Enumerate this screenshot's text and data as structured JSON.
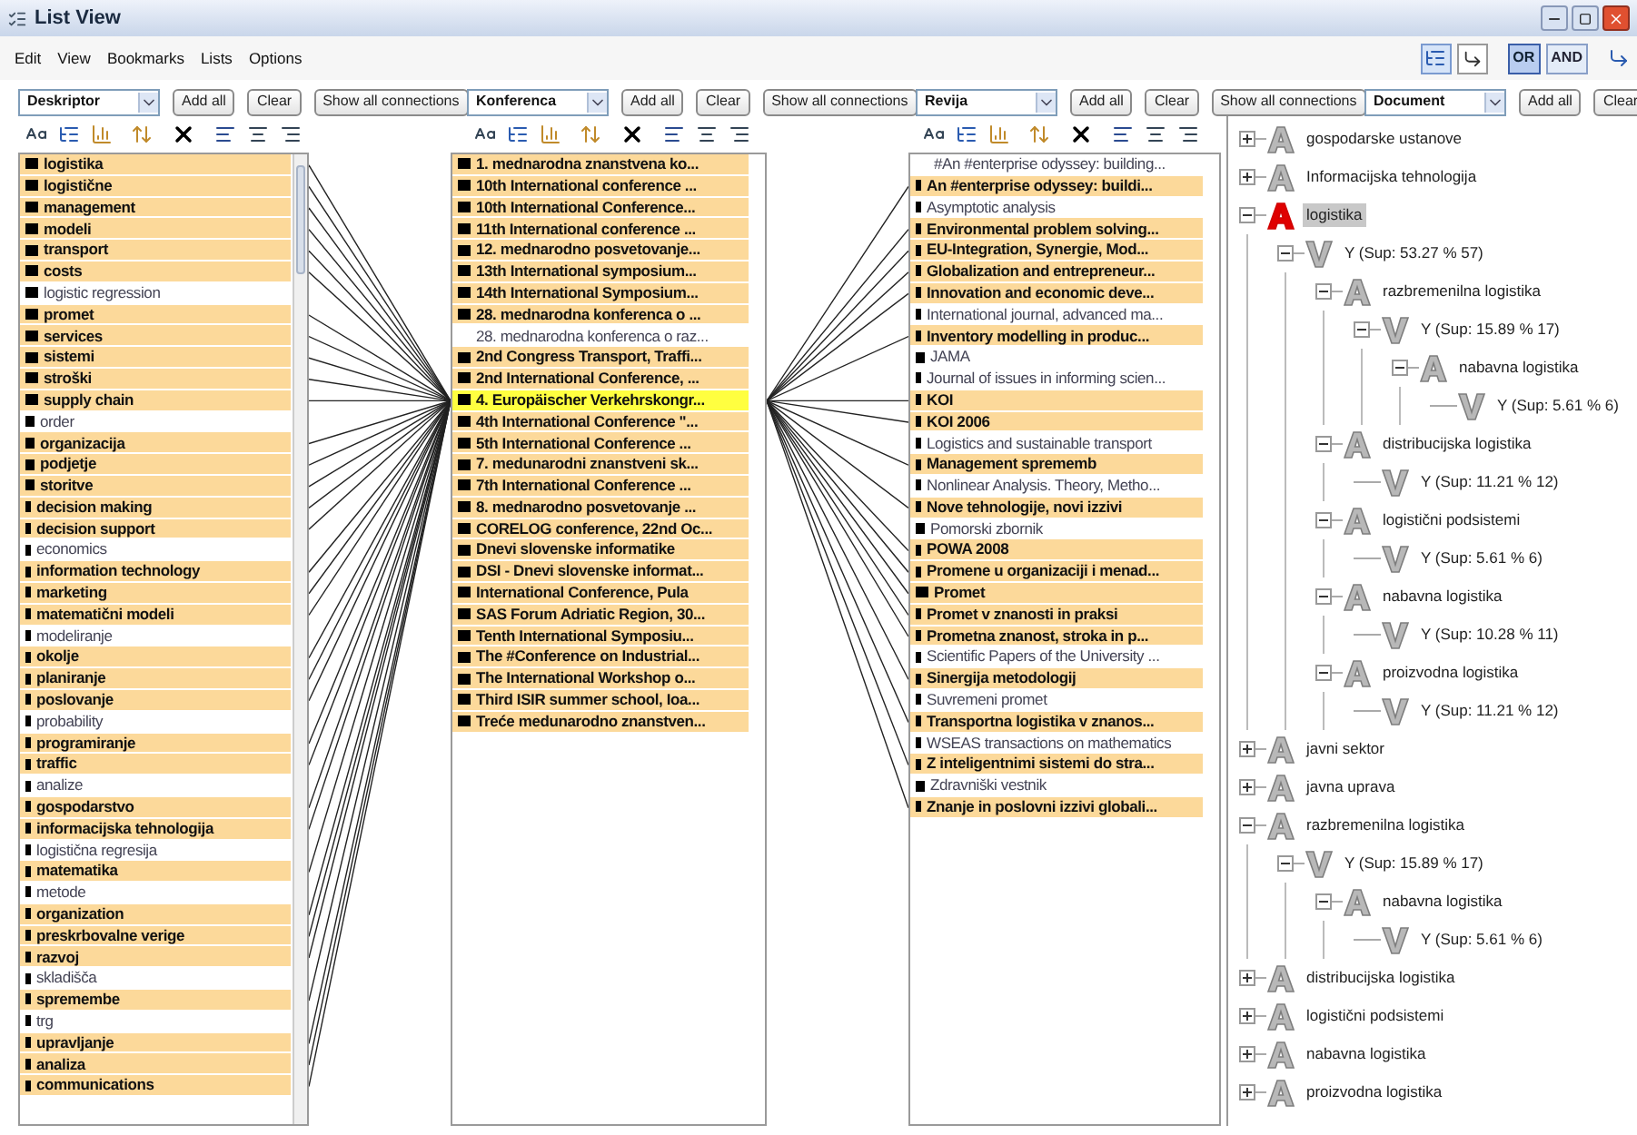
{
  "window": {
    "title": "List View"
  },
  "menu": [
    "Edit",
    "View",
    "Bookmarks",
    "Lists",
    "Options"
  ],
  "mode_buttons": [
    {
      "label": "OR",
      "selected": true
    },
    {
      "label": "AND",
      "selected": false
    }
  ],
  "panes": [
    {
      "combo": "Deskriptor",
      "buttons": [
        "Add all",
        "Clear",
        "Show all connections"
      ]
    },
    {
      "combo": "Konferenca",
      "buttons": [
        "Add all",
        "Clear",
        "Show all connections"
      ]
    },
    {
      "combo": "Revija",
      "buttons": [
        "Add all",
        "Clear",
        "Show all connections"
      ]
    },
    {
      "combo": "Document",
      "buttons": [
        "Add all",
        "Clear"
      ]
    }
  ],
  "lists": [
    {
      "items": [
        {
          "label": "logistika",
          "highlighted": true,
          "selected": false,
          "kind": "large"
        },
        {
          "label": "logistične",
          "highlighted": true,
          "selected": false,
          "kind": "large"
        },
        {
          "label": "management",
          "highlighted": true,
          "selected": false,
          "kind": "large"
        },
        {
          "label": "modeli",
          "highlighted": true,
          "selected": false,
          "kind": "large"
        },
        {
          "label": "transport",
          "highlighted": true,
          "selected": false,
          "kind": "large"
        },
        {
          "label": "costs",
          "highlighted": true,
          "selected": false,
          "kind": "large"
        },
        {
          "label": "logistic regression",
          "highlighted": false,
          "selected": false,
          "kind": "large"
        },
        {
          "label": "promet",
          "highlighted": true,
          "selected": false,
          "kind": "large"
        },
        {
          "label": "services",
          "highlighted": true,
          "selected": false,
          "kind": "large"
        },
        {
          "label": "sistemi",
          "highlighted": true,
          "selected": false,
          "kind": "large"
        },
        {
          "label": "stroški",
          "highlighted": true,
          "selected": false,
          "kind": "large"
        },
        {
          "label": "supply chain",
          "highlighted": true,
          "selected": false,
          "kind": "large"
        },
        {
          "label": "order",
          "highlighted": false,
          "selected": false,
          "kind": "medium"
        },
        {
          "label": "organizacija",
          "highlighted": true,
          "selected": false,
          "kind": "medium"
        },
        {
          "label": "podjetje",
          "highlighted": true,
          "selected": false,
          "kind": "medium"
        },
        {
          "label": "storitve",
          "highlighted": true,
          "selected": false,
          "kind": "medium"
        },
        {
          "label": "decision making",
          "highlighted": true,
          "selected": false,
          "kind": "small"
        },
        {
          "label": "decision support",
          "highlighted": true,
          "selected": false,
          "kind": "small"
        },
        {
          "label": "economics",
          "highlighted": false,
          "selected": false,
          "kind": "small"
        },
        {
          "label": "information technology",
          "highlighted": true,
          "selected": false,
          "kind": "small"
        },
        {
          "label": "marketing",
          "highlighted": true,
          "selected": false,
          "kind": "small"
        },
        {
          "label": "matematični modeli",
          "highlighted": true,
          "selected": false,
          "kind": "small"
        },
        {
          "label": "modeliranje",
          "highlighted": false,
          "selected": false,
          "kind": "small"
        },
        {
          "label": "okolje",
          "highlighted": true,
          "selected": false,
          "kind": "small"
        },
        {
          "label": "planiranje",
          "highlighted": true,
          "selected": false,
          "kind": "small"
        },
        {
          "label": "poslovanje",
          "highlighted": true,
          "selected": false,
          "kind": "small"
        },
        {
          "label": "probability",
          "highlighted": false,
          "selected": false,
          "kind": "small"
        },
        {
          "label": "programiranje",
          "highlighted": true,
          "selected": false,
          "kind": "small"
        },
        {
          "label": "traffic",
          "highlighted": true,
          "selected": false,
          "kind": "small"
        },
        {
          "label": "analize",
          "highlighted": false,
          "selected": false,
          "kind": "small"
        },
        {
          "label": "gospodarstvo",
          "highlighted": true,
          "selected": false,
          "kind": "small"
        },
        {
          "label": "informacijska tehnologija",
          "highlighted": true,
          "selected": false,
          "kind": "small"
        },
        {
          "label": "logistična regresija",
          "highlighted": false,
          "selected": false,
          "kind": "small"
        },
        {
          "label": "matematika",
          "highlighted": true,
          "selected": false,
          "kind": "small"
        },
        {
          "label": "metode",
          "highlighted": false,
          "selected": false,
          "kind": "small"
        },
        {
          "label": "organization",
          "highlighted": true,
          "selected": false,
          "kind": "small"
        },
        {
          "label": "preskrbovalne verige",
          "highlighted": true,
          "selected": false,
          "kind": "small"
        },
        {
          "label": "razvoj",
          "highlighted": true,
          "selected": false,
          "kind": "small"
        },
        {
          "label": "skladišča",
          "highlighted": false,
          "selected": false,
          "kind": "small"
        },
        {
          "label": "spremembe",
          "highlighted": true,
          "selected": false,
          "kind": "small"
        },
        {
          "label": "trg",
          "highlighted": false,
          "selected": false,
          "kind": "small"
        },
        {
          "label": "upravljanje",
          "highlighted": true,
          "selected": false,
          "kind": "small"
        },
        {
          "label": "analiza",
          "highlighted": true,
          "selected": false,
          "kind": "small"
        },
        {
          "label": "communications",
          "highlighted": true,
          "selected": false,
          "kind": "small"
        }
      ]
    },
    {
      "items": [
        {
          "label": "1. mednarodna znanstvena ko...",
          "highlighted": true,
          "selected": false,
          "kind": "large"
        },
        {
          "label": "10th International conference ...",
          "highlighted": true,
          "selected": false,
          "kind": "large"
        },
        {
          "label": "10th International Conference...",
          "highlighted": true,
          "selected": false,
          "kind": "large"
        },
        {
          "label": "11th International conference ...",
          "highlighted": true,
          "selected": false,
          "kind": "large"
        },
        {
          "label": "12. mednarodno posvetovanje...",
          "highlighted": true,
          "selected": false,
          "kind": "large"
        },
        {
          "label": "13th International symposium...",
          "highlighted": true,
          "selected": false,
          "kind": "large"
        },
        {
          "label": "14th International Symposium...",
          "highlighted": true,
          "selected": false,
          "kind": "large"
        },
        {
          "label": "28. mednarodna konferenca o ...",
          "highlighted": true,
          "selected": false,
          "kind": "large"
        },
        {
          "label": "28. mednarodna konferenca o raz...",
          "highlighted": false,
          "selected": false,
          "kind": "unmarked"
        },
        {
          "label": "2nd Congress Transport, Traffi...",
          "highlighted": true,
          "selected": false,
          "kind": "large"
        },
        {
          "label": "2nd International Conference, ...",
          "highlighted": true,
          "selected": false,
          "kind": "large"
        },
        {
          "label": "4. Europäischer Verkehrskongr...",
          "highlighted": true,
          "selected": true,
          "kind": "large"
        },
        {
          "label": "4th International Conference \"...",
          "highlighted": true,
          "selected": false,
          "kind": "large"
        },
        {
          "label": "5th International Conference ...",
          "highlighted": true,
          "selected": false,
          "kind": "large"
        },
        {
          "label": "7. medunarodni znanstveni sk...",
          "highlighted": true,
          "selected": false,
          "kind": "large"
        },
        {
          "label": "7th International Conference ...",
          "highlighted": true,
          "selected": false,
          "kind": "large"
        },
        {
          "label": "8. mednarodno posvetovanje ...",
          "highlighted": true,
          "selected": false,
          "kind": "large"
        },
        {
          "label": "CORELOG conference, 22nd Oc...",
          "highlighted": true,
          "selected": false,
          "kind": "large"
        },
        {
          "label": "Dnevi slovenske informatike",
          "highlighted": true,
          "selected": false,
          "kind": "large"
        },
        {
          "label": "DSI - Dnevi slovenske informat...",
          "highlighted": true,
          "selected": false,
          "kind": "large"
        },
        {
          "label": "International Conference, Pula",
          "highlighted": true,
          "selected": false,
          "kind": "large"
        },
        {
          "label": "SAS Forum Adriatic Region, 30...",
          "highlighted": true,
          "selected": false,
          "kind": "large"
        },
        {
          "label": "Tenth International Symposiu...",
          "highlighted": true,
          "selected": false,
          "kind": "large"
        },
        {
          "label": "The #Conference on Industrial...",
          "highlighted": true,
          "selected": false,
          "kind": "large"
        },
        {
          "label": "The International Workshop o...",
          "highlighted": true,
          "selected": false,
          "kind": "large"
        },
        {
          "label": "Third ISIR summer school, Ioa...",
          "highlighted": true,
          "selected": false,
          "kind": "large"
        },
        {
          "label": "Treće medunarodno znanstven...",
          "highlighted": true,
          "selected": false,
          "kind": "large"
        }
      ]
    },
    {
      "items": [
        {
          "label": "#An #enterprise odyssey: building...",
          "highlighted": false,
          "selected": false,
          "kind": "unmarked"
        },
        {
          "label": "An #enterprise odyssey: buildi...",
          "highlighted": true,
          "selected": false,
          "kind": "small"
        },
        {
          "label": "Asymptotic analysis",
          "highlighted": false,
          "selected": false,
          "kind": "small"
        },
        {
          "label": "Environmental problem solving...",
          "highlighted": true,
          "selected": false,
          "kind": "small"
        },
        {
          "label": "EU-Integration, Synergie, Mod...",
          "highlighted": true,
          "selected": false,
          "kind": "small"
        },
        {
          "label": "Globalization and entrepreneur...",
          "highlighted": true,
          "selected": false,
          "kind": "small"
        },
        {
          "label": "Innovation and economic deve...",
          "highlighted": true,
          "selected": false,
          "kind": "small"
        },
        {
          "label": "International journal, advanced ma...",
          "highlighted": false,
          "selected": false,
          "kind": "small"
        },
        {
          "label": "Inventory modelling in produc...",
          "highlighted": true,
          "selected": false,
          "kind": "small"
        },
        {
          "label": "JAMA",
          "highlighted": false,
          "selected": false,
          "kind": "medium"
        },
        {
          "label": "Journal of issues in informing scien...",
          "highlighted": false,
          "selected": false,
          "kind": "small"
        },
        {
          "label": "KOI",
          "highlighted": true,
          "selected": false,
          "kind": "small"
        },
        {
          "label": "KOI 2006",
          "highlighted": true,
          "selected": false,
          "kind": "small"
        },
        {
          "label": "Logistics and sustainable transport",
          "highlighted": false,
          "selected": false,
          "kind": "small"
        },
        {
          "label": "Management sprememb",
          "highlighted": true,
          "selected": false,
          "kind": "small"
        },
        {
          "label": "Nonlinear Analysis. Theory, Metho...",
          "highlighted": false,
          "selected": false,
          "kind": "small"
        },
        {
          "label": "Nove tehnologije, novi izzivi",
          "highlighted": true,
          "selected": false,
          "kind": "small"
        },
        {
          "label": "Pomorski zbornik",
          "highlighted": false,
          "selected": false,
          "kind": "medium"
        },
        {
          "label": "POWA 2008",
          "highlighted": true,
          "selected": false,
          "kind": "small"
        },
        {
          "label": "Promene u organizaciji i menad...",
          "highlighted": true,
          "selected": false,
          "kind": "small"
        },
        {
          "label": "Promet",
          "highlighted": true,
          "selected": false,
          "kind": "large"
        },
        {
          "label": "Promet v znanosti in praksi",
          "highlighted": true,
          "selected": false,
          "kind": "small"
        },
        {
          "label": "Prometna znanost, stroka in p...",
          "highlighted": true,
          "selected": false,
          "kind": "small"
        },
        {
          "label": "Scientific Papers of the University ...",
          "highlighted": false,
          "selected": false,
          "kind": "small"
        },
        {
          "label": "Sinergija metodologij",
          "highlighted": true,
          "selected": false,
          "kind": "small"
        },
        {
          "label": "Suvremeni promet",
          "highlighted": false,
          "selected": false,
          "kind": "small"
        },
        {
          "label": "Transportna logistika v znanos...",
          "highlighted": true,
          "selected": false,
          "kind": "small"
        },
        {
          "label": "WSEAS transactions on mathematics",
          "highlighted": false,
          "selected": false,
          "kind": "small"
        },
        {
          "label": "Z inteligentnimi sistemi do stra...",
          "highlighted": true,
          "selected": false,
          "kind": "small"
        },
        {
          "label": "Zdravniški vestnik",
          "highlighted": false,
          "selected": false,
          "kind": "medium"
        },
        {
          "label": "Znanje in poslovni izzivi globali...",
          "highlighted": true,
          "selected": false,
          "kind": "small"
        }
      ]
    }
  ],
  "tree": [
    {
      "label": "gospodarske ustanove",
      "kind": "attribute",
      "expanded": false,
      "selected": false
    },
    {
      "label": "Informacijska tehnologija",
      "kind": "attribute",
      "expanded": false,
      "selected": false
    },
    {
      "label": "logistika",
      "kind": "attribute",
      "expanded": true,
      "selected": true,
      "children": [
        {
          "label": "Y (Sup: 53.27 % 57)",
          "kind": "value",
          "expanded": true,
          "selected": false,
          "children": [
            {
              "label": "razbremenilna logistika",
              "kind": "attribute",
              "expanded": true,
              "selected": false,
              "children": [
                {
                  "label": "Y (Sup: 15.89 % 17)",
                  "kind": "value",
                  "expanded": true,
                  "selected": false,
                  "children": [
                    {
                      "label": "nabavna logistika",
                      "kind": "attribute",
                      "expanded": true,
                      "selected": false,
                      "children": [
                        {
                          "label": "Y (Sup:  5.61 % 6)",
                          "kind": "value",
                          "selected": false
                        }
                      ]
                    }
                  ]
                }
              ]
            },
            {
              "label": "distribucijska logistika",
              "kind": "attribute",
              "expanded": true,
              "selected": false,
              "children": [
                {
                  "label": "Y (Sup: 11.21 % 12)",
                  "kind": "value",
                  "selected": false
                }
              ]
            },
            {
              "label": "logistični podsistemi",
              "kind": "attribute",
              "expanded": true,
              "selected": false,
              "children": [
                {
                  "label": "Y (Sup:  5.61 % 6)",
                  "kind": "value",
                  "selected": false
                }
              ]
            },
            {
              "label": "nabavna logistika",
              "kind": "attribute",
              "expanded": true,
              "selected": false,
              "children": [
                {
                  "label": "Y (Sup: 10.28 % 11)",
                  "kind": "value",
                  "selected": false
                }
              ]
            },
            {
              "label": "proizvodna logistika",
              "kind": "attribute",
              "expanded": true,
              "selected": false,
              "children": [
                {
                  "label": "Y (Sup: 11.21 % 12)",
                  "kind": "value",
                  "selected": false
                }
              ]
            }
          ]
        }
      ]
    },
    {
      "label": "javni sektor",
      "kind": "attribute",
      "expanded": false,
      "selected": false
    },
    {
      "label": "javna uprava",
      "kind": "attribute",
      "expanded": false,
      "selected": false
    },
    {
      "label": "razbremenilna logistika",
      "kind": "attribute",
      "expanded": true,
      "selected": false,
      "children": [
        {
          "label": "Y (Sup: 15.89 % 17)",
          "kind": "value",
          "expanded": true,
          "selected": false,
          "children": [
            {
              "label": "nabavna logistika",
              "kind": "attribute",
              "expanded": true,
              "selected": false,
              "children": [
                {
                  "label": "Y (Sup:  5.61 % 6)",
                  "kind": "value",
                  "selected": false
                }
              ]
            }
          ]
        }
      ]
    },
    {
      "label": "distribucijska logistika",
      "kind": "attribute",
      "expanded": false,
      "selected": false
    },
    {
      "label": "logistični podsistemi",
      "kind": "attribute",
      "expanded": false,
      "selected": false
    },
    {
      "label": "nabavna logistika",
      "kind": "attribute",
      "expanded": false,
      "selected": false
    },
    {
      "label": "proizvodna logistika",
      "kind": "attribute",
      "expanded": false,
      "selected": false
    }
  ]
}
